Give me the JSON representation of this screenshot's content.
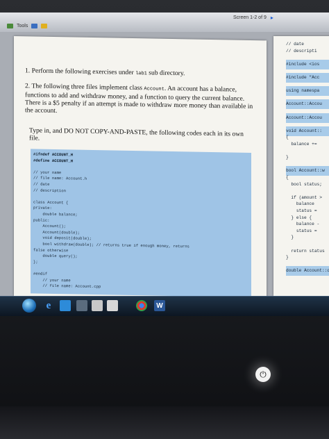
{
  "toolbar": {
    "tools_label": "Tools",
    "page_indicator": "Screen 1-2 of 9",
    "next_arrow": "▸"
  },
  "document": {
    "q1": {
      "number": "1.",
      "text_before": "Perform the following exercises under ",
      "code": "lab1",
      "text_after": " sub directory."
    },
    "q2": {
      "number": "2.",
      "text_before": "The following three files implement class ",
      "code": "Account",
      "text_after": ". An account has a balance, functions to add and withdraw money, and a function to query the current balance. There is a $5 penalty if an attempt is made to withdraw more money than available in the account."
    },
    "q3": {
      "text": "Type in, and DO NOT COPY-AND-PASTE, the following codes each in its own file."
    },
    "code_lines": [
      "#ifndef ACCOUNT_H",
      "#define ACCOUNT_H",
      "",
      "// your name",
      "// file name: Account.h",
      "// date",
      "// description",
      "",
      "class Account {",
      "private:",
      "    double balance;",
      "public:",
      "    Account();",
      "    Account(double);",
      "    void deposit(double);",
      "    bool withdraw(double); // returns true if enough money, returns",
      "false otherwise",
      "    double query();",
      "};",
      "",
      "#endif",
      "    // your name",
      "    // file name: Account.cpp"
    ],
    "right_page_lines": [
      "// date",
      "// descripti",
      "",
      "#include <ios",
      "",
      "#include \"Acc",
      "",
      "using namespa",
      "",
      "Account::Accou",
      "",
      "Account::Accou",
      "",
      "void Account::",
      "{",
      "  balance +=",
      "",
      "}",
      "",
      "bool Account::w",
      "{",
      "  bool status;",
      "",
      "  if (amount >",
      "    balance",
      "    status =",
      "  } else {",
      "    balance -",
      "    status =",
      "  }",
      "",
      "  return status",
      "}",
      "",
      "double Account::qu"
    ]
  },
  "taskbar": {
    "items": [
      "start",
      "ie",
      "media",
      "explorer",
      "chrome",
      "word"
    ],
    "word_letter": "W",
    "ie_letter": "e"
  },
  "power": {
    "symbol": "⏻"
  }
}
